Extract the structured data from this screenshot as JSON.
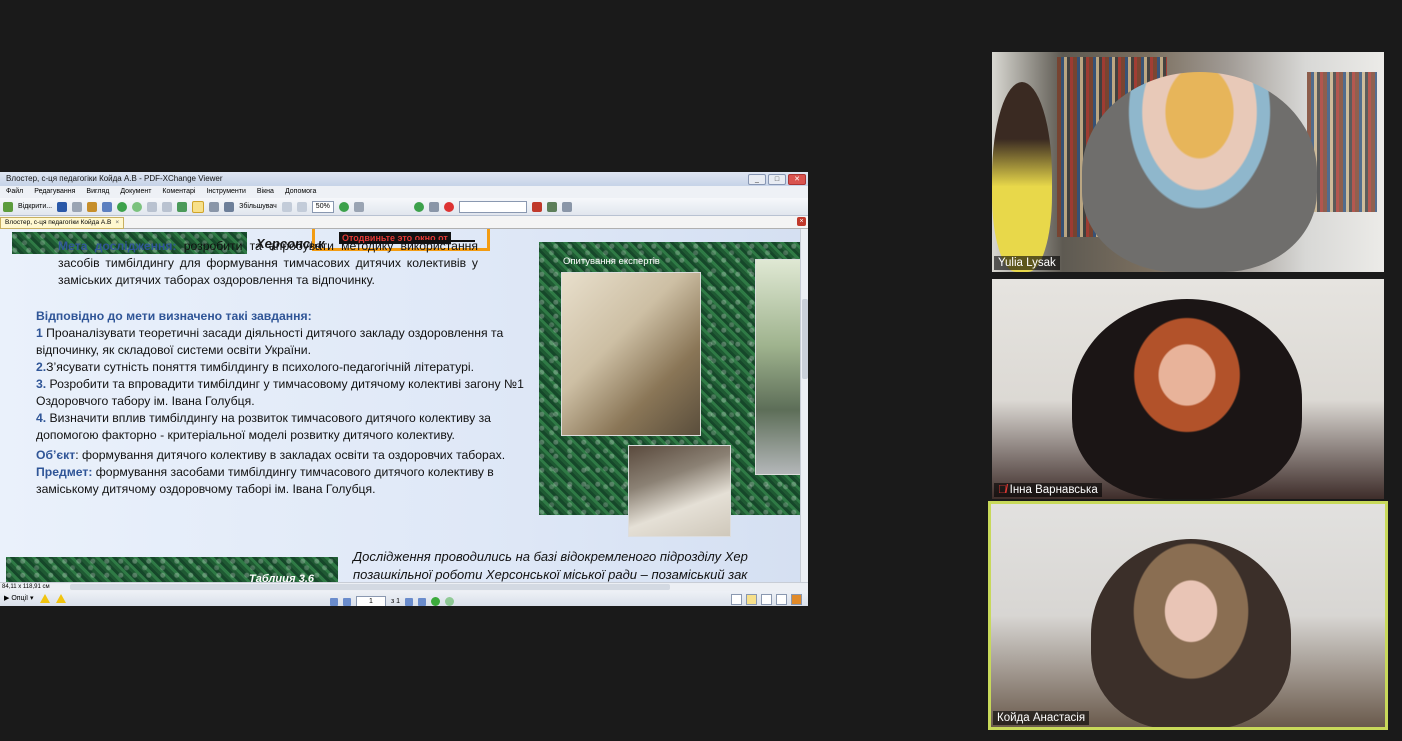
{
  "viewer": {
    "title": "Влостер, с-ця педагогіки Койда А.В - PDF-XChange Viewer",
    "menu": [
      "Файл",
      "Редагування",
      "Вигляд",
      "Документ",
      "Коментарі",
      "Інструменти",
      "Вікна",
      "Допомога"
    ],
    "toolbar": {
      "open_label": "Відкрити...",
      "zoom_mode": "Збільшувач",
      "zoom_value": "50%"
    },
    "doc_tab": "Влостер, с-ця педагогіки Койда А.В",
    "page_size": "84,11 x 118,91 см",
    "status_options": "Опції",
    "page_current": "1",
    "page_total": "з 1"
  },
  "overlay_text": "Отодвиньте это окно от",
  "slide": {
    "title": "Херсонськ",
    "goal_label": "Мета дослідження:",
    "goal_text": " розробити та апробувати методику використання засобів тимбілдингу для формування тимчасових дитячих колективів у заміських дитячих таборах оздоровлення та відпочинку.",
    "tasks_heading": "Відповідно до мети визначено такі завдання:",
    "tasks": [
      {
        "num": "1",
        "text": " Проаналізувати теоретичні засади діяльності дитячого закладу оздоровлення та відпочинку,  як складової системи освіти України."
      },
      {
        "num": "2.",
        "text": "З’ясувати сутність поняття тимбілдингу в психолого-педагогічній літературі."
      },
      {
        "num": "3.",
        "text": " Розробити та впровадити тимбілдинг у тимчасовому дитячому колективі загону №1 Оздоровчого табору ім. Івана Голубця."
      },
      {
        "num": "4.",
        "text": " Визначити вплив  тимбілдингу на розвиток тимчасового дитячого колективу за допомогою  факторно - критеріальної моделі розвитку дитячого колективу."
      }
    ],
    "object_label": "Об’єкт",
    "object_text": ": формування дитячого колективу в закладах освіти та оздоровчих таборах.",
    "subject_label": "Предмет:",
    "subject_text": " формування засобами тимбілдингу тимчасового дитячого колективу в заміському дитячому оздоровчому таборі ім. Івана Голубця.",
    "expert_caption": "Опитування експертів",
    "table_label": "Таблиця 3.6",
    "footnote_line1": "Дослідження проводились на базі відокремленого підрозділу Хер",
    "footnote_line2": "позашкільної роботи Херсонської міської ради – позаміський зак"
  },
  "participants": [
    {
      "name": "Yulia Lysak",
      "muted": false
    },
    {
      "name": "Інна Варнавська",
      "muted": true
    },
    {
      "name": "Койда Анастасія",
      "muted": false,
      "active_speaker": true
    }
  ],
  "colors": {
    "accent_blue": "#2f5597",
    "speaker_border": "#c8d95a",
    "overlay_border": "#f39c12"
  }
}
